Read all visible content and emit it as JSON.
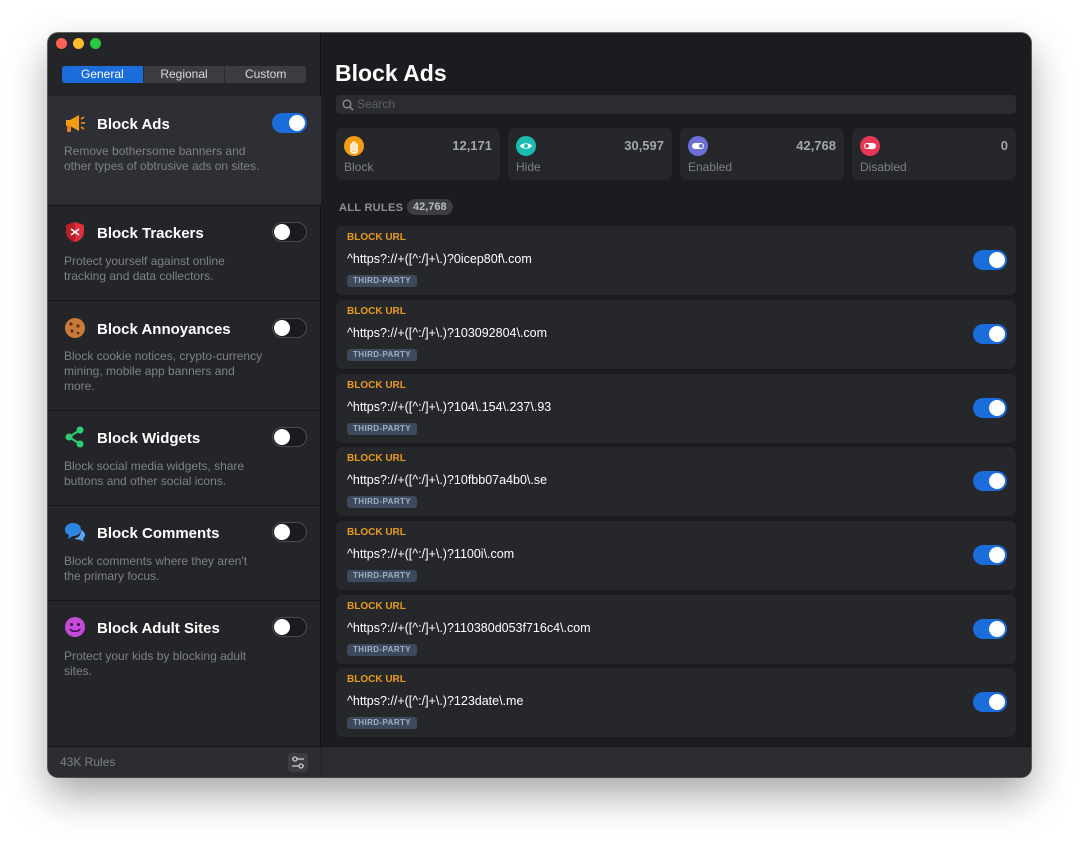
{
  "sidebar": {
    "segments": [
      "General",
      "Regional",
      "Custom"
    ],
    "active_segment": "General",
    "categories": [
      {
        "title": "Block Ads",
        "desc": "Remove bothersome banners and other types of obtrusive ads on sites.",
        "enabled": true,
        "icon": "megaphone-icon",
        "color": "#f39c12"
      },
      {
        "title": "Block Trackers",
        "desc": "Protect yourself against online tracking and data collectors.",
        "enabled": false,
        "icon": "shield-icon",
        "color": "#e0303b"
      },
      {
        "title": "Block Annoyances",
        "desc": "Block cookie notices, crypto-currency mining, mobile app banners and more.",
        "enabled": false,
        "icon": "cookie-icon",
        "color": "#c87a3a"
      },
      {
        "title": "Block Widgets",
        "desc": "Block social media widgets, share buttons and other social icons.",
        "enabled": false,
        "icon": "share-icon",
        "color": "#2ecc71"
      },
      {
        "title": "Block Comments",
        "desc": "Block comments where they aren't the primary focus.",
        "enabled": false,
        "icon": "speech-bubbles-icon",
        "color": "#2e86de"
      },
      {
        "title": "Block Adult Sites",
        "desc": "Protect your kids by blocking adult sites.",
        "enabled": false,
        "icon": "smiley-icon",
        "color": "#c44bd8"
      }
    ],
    "footer_rules": "43K Rules"
  },
  "main": {
    "title": "Block Ads",
    "search_placeholder": "Search",
    "stats": [
      {
        "label": "Block",
        "value": "12,171",
        "icon": "hand-icon",
        "color": "#f39c12"
      },
      {
        "label": "Hide",
        "value": "30,597",
        "icon": "eye-icon",
        "color": "#1abcb0"
      },
      {
        "label": "Enabled",
        "value": "42,768",
        "icon": "toggle-on-icon",
        "color": "#6c6fd6"
      },
      {
        "label": "Disabled",
        "value": "0",
        "icon": "toggle-off-icon",
        "color": "#e63757"
      }
    ],
    "all_rules_label": "ALL RULES",
    "all_rules_count": "42,768",
    "rules": [
      {
        "type": "BLOCK URL",
        "pattern": "^https?://+([^:/]+\\.)?0icep80f\\.com",
        "tag": "THIRD-PARTY",
        "enabled": true
      },
      {
        "type": "BLOCK URL",
        "pattern": "^https?://+([^:/]+\\.)?103092804\\.com",
        "tag": "THIRD-PARTY",
        "enabled": true
      },
      {
        "type": "BLOCK URL",
        "pattern": "^https?://+([^:/]+\\.)?104\\.154\\.237\\.93",
        "tag": "THIRD-PARTY",
        "enabled": true
      },
      {
        "type": "BLOCK URL",
        "pattern": "^https?://+([^:/]+\\.)?10fbb07a4b0\\.se",
        "tag": "THIRD-PARTY",
        "enabled": true
      },
      {
        "type": "BLOCK URL",
        "pattern": "^https?://+([^:/]+\\.)?1100i\\.com",
        "tag": "THIRD-PARTY",
        "enabled": true
      },
      {
        "type": "BLOCK URL",
        "pattern": "^https?://+([^:/]+\\.)?110380d053f716c4\\.com",
        "tag": "THIRD-PARTY",
        "enabled": true
      },
      {
        "type": "BLOCK URL",
        "pattern": "^https?://+([^:/]+\\.)?123date\\.me",
        "tag": "THIRD-PARTY",
        "enabled": true
      }
    ]
  }
}
